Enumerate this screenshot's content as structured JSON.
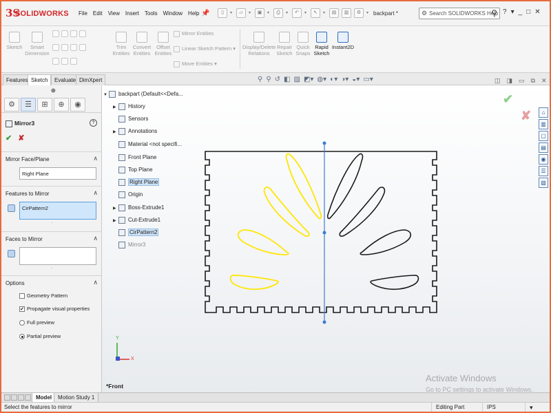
{
  "app": {
    "logo_mark": "3S",
    "logo_text": "SOLIDWORKS",
    "document_title": "backpart *"
  },
  "menu": [
    "File",
    "Edit",
    "View",
    "Insert",
    "Tools",
    "Window",
    "Help"
  ],
  "search": {
    "placeholder": "Search SOLIDWORKS Help"
  },
  "window_controls": {
    "help": "?",
    "minimize": "_",
    "restore": "□",
    "close": "✕"
  },
  "ribbon": {
    "sketch": "Sketch",
    "smart_dimension_1": "Smart",
    "smart_dimension_2": "Dimension",
    "trim_1": "Trim",
    "trim_2": "Entities",
    "convert_1": "Convert",
    "convert_2": "Entities",
    "offset_1": "Offset",
    "offset_2": "Entities",
    "mirror_entities": "Mirror Entities",
    "linear_pattern": "Linear Sketch Pattern",
    "move_entities": "Move Entities",
    "display_delete_1": "Display/Delete",
    "display_delete_2": "Relations",
    "repair_1": "Repair",
    "repair_2": "Sketch",
    "quick_snaps_1": "Quick",
    "quick_snaps_2": "Snaps",
    "rapid_1": "Rapid",
    "rapid_2": "Sketch",
    "instant2d": "Instant2D"
  },
  "tabs": [
    "Features",
    "Sketch",
    "Evaluate",
    "DimXpert"
  ],
  "property_manager": {
    "title": "Mirror3",
    "help": "?",
    "ok": "✔",
    "cancel": "✘",
    "mirror_face_header": "Mirror Face/Plane",
    "mirror_face_value": "Right Plane",
    "features_header": "Features to Mirror",
    "features_value": "CirPattern2",
    "faces_header": "Faces to Mirror",
    "faces_value": "",
    "options_header": "Options",
    "geometry_pattern": "Geometry Pattern",
    "propagate": "Propagate visual properties",
    "full_preview": "Full preview",
    "partial_preview": "Partial preview",
    "geometry_pattern_checked": false,
    "propagate_checked": true,
    "preview_mode": "partial"
  },
  "tree": {
    "root": "backpart  (Default<<Defa...",
    "items": [
      "History",
      "Sensors",
      "Annotations",
      "Material <not specifi...",
      "Front Plane",
      "Top Plane",
      "Right Plane",
      "Origin",
      "Boss-Extrude1",
      "Cut-Extrude1",
      "CirPattern2",
      "Mirror3"
    ]
  },
  "viewport": {
    "view_name": "*Front",
    "watermark_title": "Activate Windows",
    "watermark_sub": "Go to PC settings to activate Windows.",
    "axis_y": "Y",
    "axis_x": "X"
  },
  "bottom_tabs": [
    "Model",
    "Motion Study 1"
  ],
  "status": {
    "message": "Select the features to mirror",
    "mode": "Editing Part",
    "units": "IPS"
  },
  "colors": {
    "accent": "#2a6ebd",
    "preview_yellow": "#ffe600",
    "selection": "#cfe6fb",
    "brand_red": "#d6262a"
  }
}
